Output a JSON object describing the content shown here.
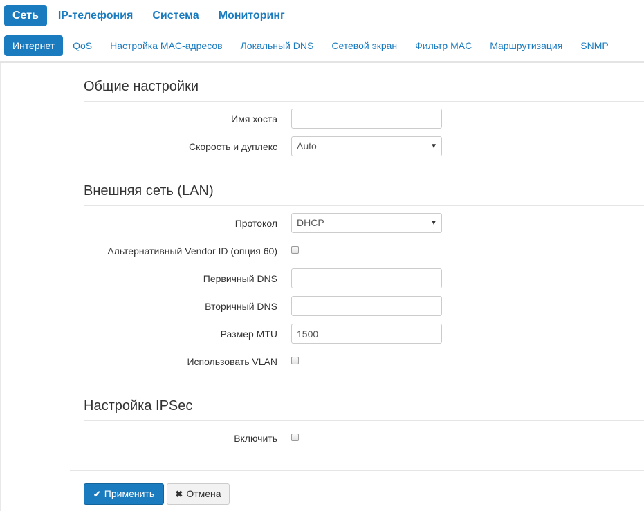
{
  "top_nav": [
    {
      "label": "Сеть",
      "active": true
    },
    {
      "label": "IP-телефония",
      "active": false
    },
    {
      "label": "Система",
      "active": false
    },
    {
      "label": "Мониторинг",
      "active": false
    }
  ],
  "sub_nav": [
    {
      "label": "Интернет",
      "active": true
    },
    {
      "label": "QoS",
      "active": false
    },
    {
      "label": "Настройка MAC-адресов",
      "active": false
    },
    {
      "label": "Локальный DNS",
      "active": false
    },
    {
      "label": "Сетевой экран",
      "active": false
    },
    {
      "label": "Фильтр MAC",
      "active": false
    },
    {
      "label": "Маршрутизация",
      "active": false
    },
    {
      "label": "SNMP",
      "active": false
    }
  ],
  "general": {
    "title": "Общие настройки",
    "hostname_label": "Имя хоста",
    "hostname_value": "",
    "speed_label": "Скорость и дуплекс",
    "speed_value": "Auto"
  },
  "lan": {
    "title": "Внешняя сеть (LAN)",
    "protocol_label": "Протокол",
    "protocol_value": "DHCP",
    "vendor_label": "Альтернативный Vendor ID (опция 60)",
    "vendor_checked": false,
    "dns1_label": "Первичный DNS",
    "dns1_value": "",
    "dns2_label": "Вторичный DNS",
    "dns2_value": "",
    "mtu_label": "Размер MTU",
    "mtu_value": "1500",
    "vlan_label": "Использовать VLAN",
    "vlan_checked": false
  },
  "ipsec": {
    "title": "Настройка IPSec",
    "enable_label": "Включить",
    "enable_checked": false
  },
  "buttons": {
    "apply_label": "Применить",
    "apply_icon": "check-icon",
    "cancel_label": "Отмена",
    "cancel_icon": "close-icon"
  },
  "colors": {
    "accent": "#1a7bbf"
  }
}
